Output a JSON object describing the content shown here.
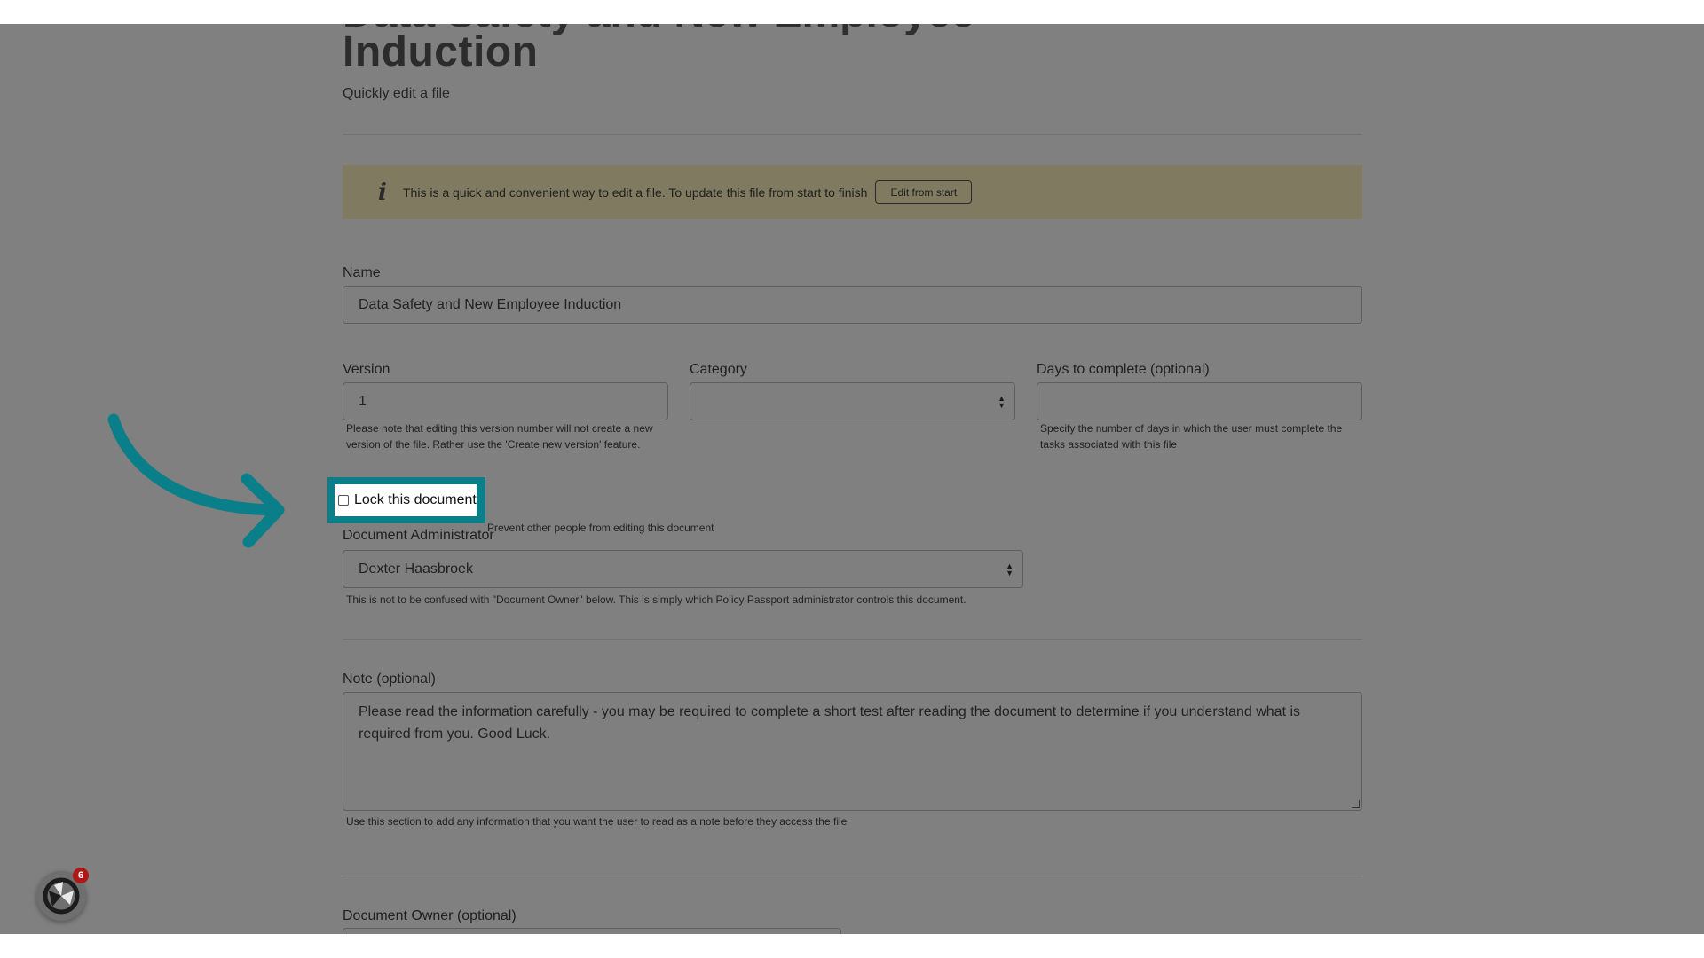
{
  "page": {
    "title_clipped": "Data Safety and New Employee",
    "title": "Induction",
    "subtitle": "Quickly edit a file"
  },
  "info_banner": {
    "icon": "info-icon",
    "text": "This is a quick and convenient way to edit a file. To update this file from start to finish",
    "button_label": "Edit from start"
  },
  "form": {
    "name": {
      "label": "Name",
      "value": "Data Safety and New Employee Induction"
    },
    "version": {
      "label": "Version",
      "value": "1",
      "help": "Please note that editing this version number will not create a new version of the file. Rather use the 'Create new version' feature."
    },
    "category": {
      "label": "Category",
      "value": ""
    },
    "days_to_complete": {
      "label": "Days to complete (optional)",
      "value": "",
      "help": "Specify the number of days in which the user must complete the tasks associated with this file"
    },
    "lock": {
      "label": "Lock this document",
      "checked": false,
      "description": "Prevent other people from editing this document"
    },
    "document_administrator": {
      "label": "Document Administrator",
      "value": "Dexter Haasbroek",
      "help": "This is not to be confused with \"Document Owner\" below. This is simply which Policy Passport administrator controls this document."
    },
    "note": {
      "label": "Note (optional)",
      "value": "Please read the information carefully - you may be required to complete a short test after reading the document to determine if you understand what is required from you. Good Luck.",
      "help": "Use this section to add any information that you want the user to read as a note before they access the file"
    },
    "document_owner": {
      "label": "Document Owner (optional)"
    }
  },
  "overlay": {
    "highlight_color": "#0b7f89",
    "backdrop_color": "#808080"
  },
  "chat": {
    "icon": "chat-launcher-logo-icon",
    "badge_count": "6"
  }
}
